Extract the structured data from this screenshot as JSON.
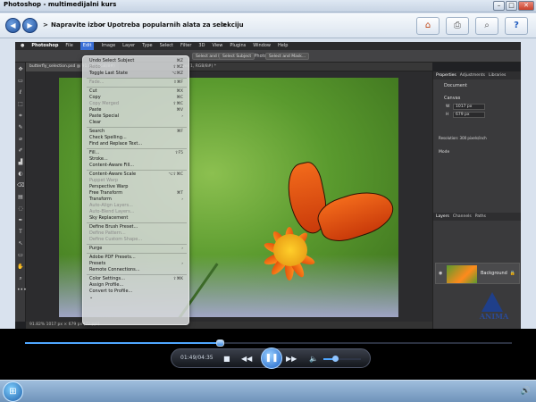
{
  "window": {
    "title": "Photoshop - multimedijalni kurs"
  },
  "window_buttons": {
    "minimize": "–",
    "maximize": "□",
    "close": "✕"
  },
  "nav": {
    "back_label": "◀",
    "forward_label": "▶",
    "separator": ">",
    "breadcrumb": [
      "Napravite izbor",
      "Upotreba popularnih alata za selekciju"
    ],
    "buttons": [
      {
        "name": "home-button",
        "icon": "⌂"
      },
      {
        "name": "print-button",
        "icon": "⎙"
      },
      {
        "name": "search-button",
        "icon": "⌕"
      },
      {
        "name": "help-button",
        "icon": "?"
      }
    ]
  },
  "photoshop": {
    "menubar": [
      "Photoshop",
      "File",
      "Edit",
      "Image",
      "Layer",
      "Type",
      "Select",
      "Filter",
      "3D",
      "View",
      "Plugins",
      "Window",
      "Help"
    ],
    "active_menu": "Edit",
    "app_title": "Adobe Photoshop",
    "options_buttons": [
      "Select and Mask...",
      "Select Subject",
      "Select and Mask..."
    ],
    "doc_tab": "butterfly_selection.psd @ 91.8% (RGB/8#)",
    "doc_tab2": "Layer 1, RGB/8#) *",
    "status": "91.82%      1017 px × 679 px (72 ppi)",
    "tools": [
      "✥",
      "▭",
      "ℓ",
      "⬚",
      "⌗",
      "✎",
      "⌀",
      "✐",
      "▟",
      "◐",
      "⌫",
      "▤",
      "◌",
      "✒",
      "T",
      "↖",
      "▭",
      "✋",
      "⌕",
      "•••"
    ],
    "panel": {
      "tabs": [
        "Properties",
        "Adjustments",
        "Libraries"
      ],
      "doc_label": "Document",
      "canvas_label": "Canvas",
      "w_value": "1017 px",
      "h_value": "679 px",
      "resolution": "Resolution: 300 pixels/inch",
      "mode_label": "Mode",
      "layer_tabs": [
        "Layers",
        "Channels",
        "Paths"
      ],
      "layer_name": "Background"
    },
    "edit_menu": [
      {
        "label": "Undo Select Subject",
        "shortcut": "⌘Z",
        "disabled": false
      },
      {
        "label": "Redo",
        "shortcut": "⇧⌘Z",
        "disabled": true
      },
      {
        "label": "Toggle Last State",
        "shortcut": "⌥⌘Z",
        "disabled": false
      },
      {
        "sep": true
      },
      {
        "label": "Fade...",
        "shortcut": "⇧⌘F",
        "disabled": true
      },
      {
        "sep": true
      },
      {
        "label": "Cut",
        "shortcut": "⌘X",
        "disabled": false
      },
      {
        "label": "Copy",
        "shortcut": "⌘C",
        "disabled": false
      },
      {
        "label": "Copy Merged",
        "shortcut": "⇧⌘C",
        "disabled": true
      },
      {
        "label": "Paste",
        "shortcut": "⌘V",
        "disabled": false
      },
      {
        "label": "Paste Special",
        "shortcut": "›",
        "disabled": false
      },
      {
        "label": "Clear",
        "shortcut": "",
        "disabled": false
      },
      {
        "sep": true
      },
      {
        "label": "Search",
        "shortcut": "⌘F",
        "disabled": false
      },
      {
        "label": "Check Spelling...",
        "shortcut": "",
        "disabled": false
      },
      {
        "label": "Find and Replace Text...",
        "shortcut": "",
        "disabled": false
      },
      {
        "sep": true
      },
      {
        "label": "Fill...",
        "shortcut": "⇧F5",
        "disabled": false
      },
      {
        "label": "Stroke...",
        "shortcut": "",
        "disabled": false
      },
      {
        "label": "Content-Aware Fill...",
        "shortcut": "",
        "disabled": false
      },
      {
        "sep": true
      },
      {
        "label": "Content-Aware Scale",
        "shortcut": "⌥⇧⌘C",
        "disabled": false
      },
      {
        "label": "Puppet Warp",
        "shortcut": "",
        "disabled": true
      },
      {
        "label": "Perspective Warp",
        "shortcut": "",
        "disabled": false
      },
      {
        "label": "Free Transform",
        "shortcut": "⌘T",
        "disabled": false
      },
      {
        "label": "Transform",
        "shortcut": "›",
        "disabled": false
      },
      {
        "label": "Auto-Align Layers...",
        "shortcut": "",
        "disabled": true
      },
      {
        "label": "Auto-Blend Layers...",
        "shortcut": "",
        "disabled": true
      },
      {
        "label": "Sky Replacement",
        "shortcut": "",
        "disabled": false
      },
      {
        "sep": true
      },
      {
        "label": "Define Brush Preset...",
        "shortcut": "",
        "disabled": false
      },
      {
        "label": "Define Pattern...",
        "shortcut": "",
        "disabled": true
      },
      {
        "label": "Define Custom Shape...",
        "shortcut": "",
        "disabled": true
      },
      {
        "sep": true
      },
      {
        "label": "Purge",
        "shortcut": "›",
        "disabled": false
      },
      {
        "sep": true
      },
      {
        "label": "Adobe PDF Presets...",
        "shortcut": "",
        "disabled": false
      },
      {
        "label": "Presets",
        "shortcut": "›",
        "disabled": false
      },
      {
        "label": "Remote Connections...",
        "shortcut": "",
        "disabled": false
      },
      {
        "sep": true
      },
      {
        "label": "Color Settings...",
        "shortcut": "⇧⌘K",
        "disabled": false
      },
      {
        "label": "Assign Profile...",
        "shortcut": "",
        "disabled": false
      },
      {
        "label": "Convert to Profile...",
        "shortcut": "",
        "disabled": false
      },
      {
        "label": "⌄",
        "shortcut": "",
        "disabled": false
      }
    ]
  },
  "logo": {
    "text": "ANIMA"
  },
  "player": {
    "time": "01:49/04:35",
    "progress": 0.4,
    "volume": 0.3,
    "stop_icon": "■",
    "rewind_icon": "◀◀",
    "play_pause_icon": "❚❚",
    "forward_icon": "▶▶",
    "volume_icon": "🔈"
  },
  "taskbar": {
    "start_icon": "⊞",
    "tray_icon": "🔊"
  }
}
